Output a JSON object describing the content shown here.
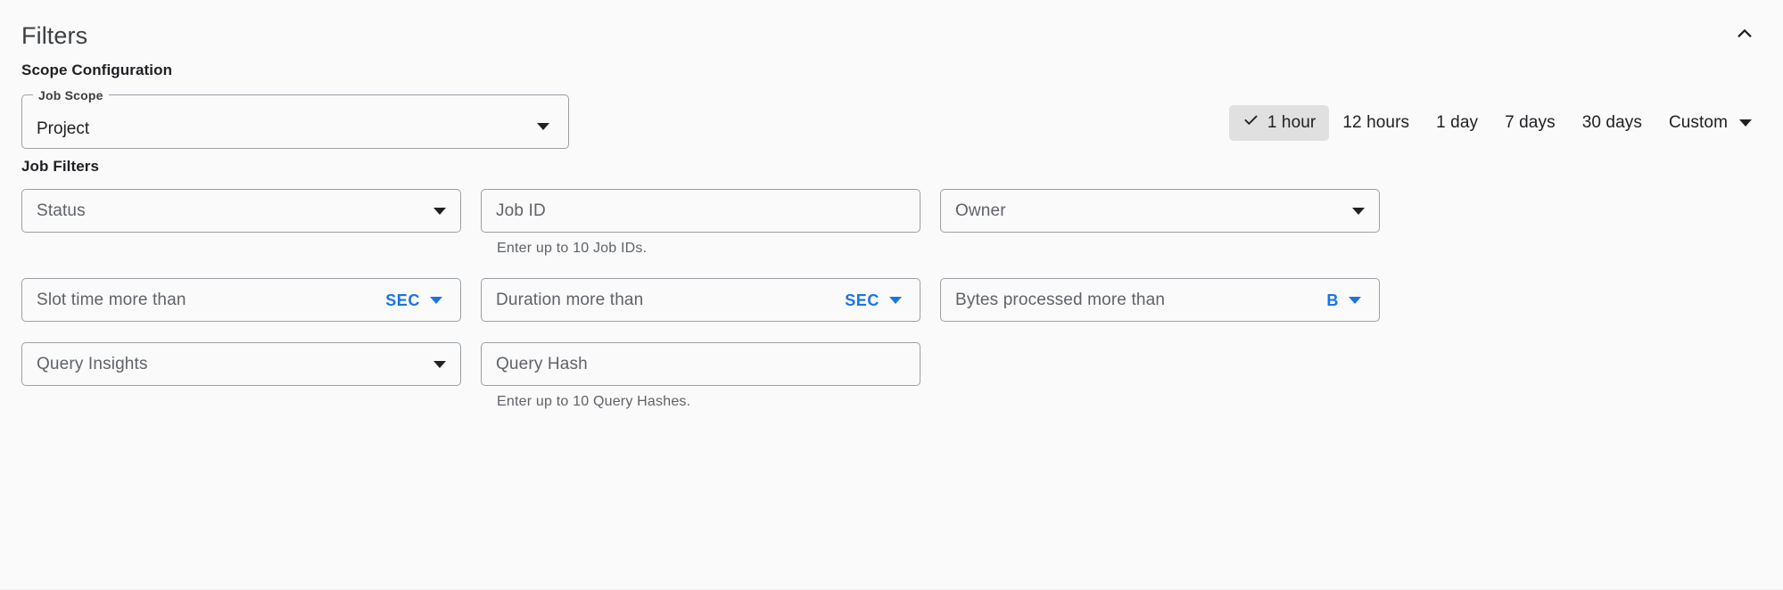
{
  "header": {
    "title": "Filters",
    "collapse_icon": "chevron-up-icon"
  },
  "scope_section": {
    "heading": "Scope Configuration",
    "job_scope": {
      "label": "Job Scope",
      "value": "Project",
      "icon": "chevron-down-icon"
    }
  },
  "time_range": {
    "options": [
      {
        "label": "1 hour",
        "selected": true
      },
      {
        "label": "12 hours",
        "selected": false
      },
      {
        "label": "1 day",
        "selected": false
      },
      {
        "label": "7 days",
        "selected": false
      },
      {
        "label": "30 days",
        "selected": false
      }
    ],
    "custom": {
      "label": "Custom",
      "icon": "chevron-down-icon"
    },
    "check_icon": "check-icon",
    "selected_background": "#e0e0e0"
  },
  "job_filters": {
    "heading": "Job Filters",
    "status": {
      "placeholder": "Status",
      "icon": "chevron-down-icon"
    },
    "job_id": {
      "placeholder": "Job ID",
      "hint": "Enter up to 10 Job IDs."
    },
    "owner": {
      "placeholder": "Owner",
      "icon": "chevron-down-icon"
    },
    "slot_time": {
      "placeholder": "Slot time more than",
      "unit": "SEC",
      "icon": "chevron-down-icon"
    },
    "duration": {
      "placeholder": "Duration more than",
      "unit": "SEC",
      "icon": "chevron-down-icon"
    },
    "bytes_processed": {
      "placeholder": "Bytes processed more than",
      "unit": "B",
      "icon": "chevron-down-icon"
    },
    "query_insights": {
      "placeholder": "Query Insights",
      "icon": "chevron-down-icon"
    },
    "query_hash": {
      "placeholder": "Query Hash",
      "hint": "Enter up to 10 Query Hashes."
    }
  },
  "colors": {
    "accent": "#1a73e8",
    "background": "#fafafa",
    "border": "#9aa0a6",
    "text_primary": "#202124",
    "text_secondary": "#5f6368"
  }
}
